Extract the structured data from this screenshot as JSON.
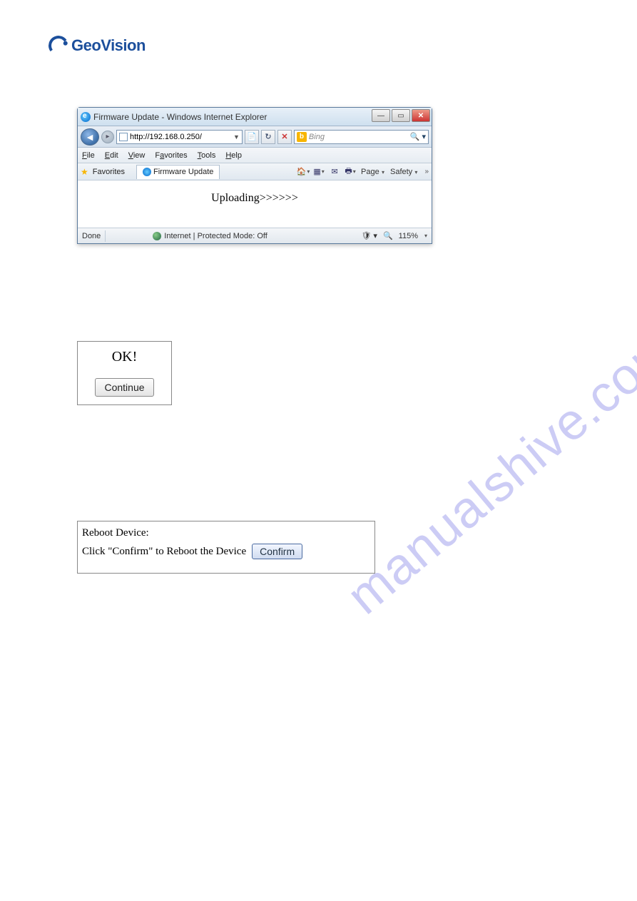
{
  "logo": {
    "text": "GeoVision"
  },
  "ie_window": {
    "title": "Firmware Update - Windows Internet Explorer",
    "url": "http://192.168.0.250/",
    "search_provider": "Bing",
    "menu": {
      "file": "File",
      "edit": "Edit",
      "view": "View",
      "favorites": "Favorites",
      "tools": "Tools",
      "help": "Help"
    },
    "favorites_label": "Favorites",
    "tab_label": "Firmware Update",
    "toolbar": {
      "page": "Page",
      "safety": "Safety"
    },
    "content": "Uploading>>>>>>",
    "status_left": "Done",
    "status_mode": "Internet | Protected Mode: Off",
    "zoom": "115%"
  },
  "ok_box": {
    "title": "OK!",
    "button": "Continue"
  },
  "reboot_box": {
    "title": "Reboot Device:",
    "instruction": "Click \"Confirm\" to Reboot the Device",
    "button": "Confirm"
  },
  "watermark": "manualshive.com"
}
